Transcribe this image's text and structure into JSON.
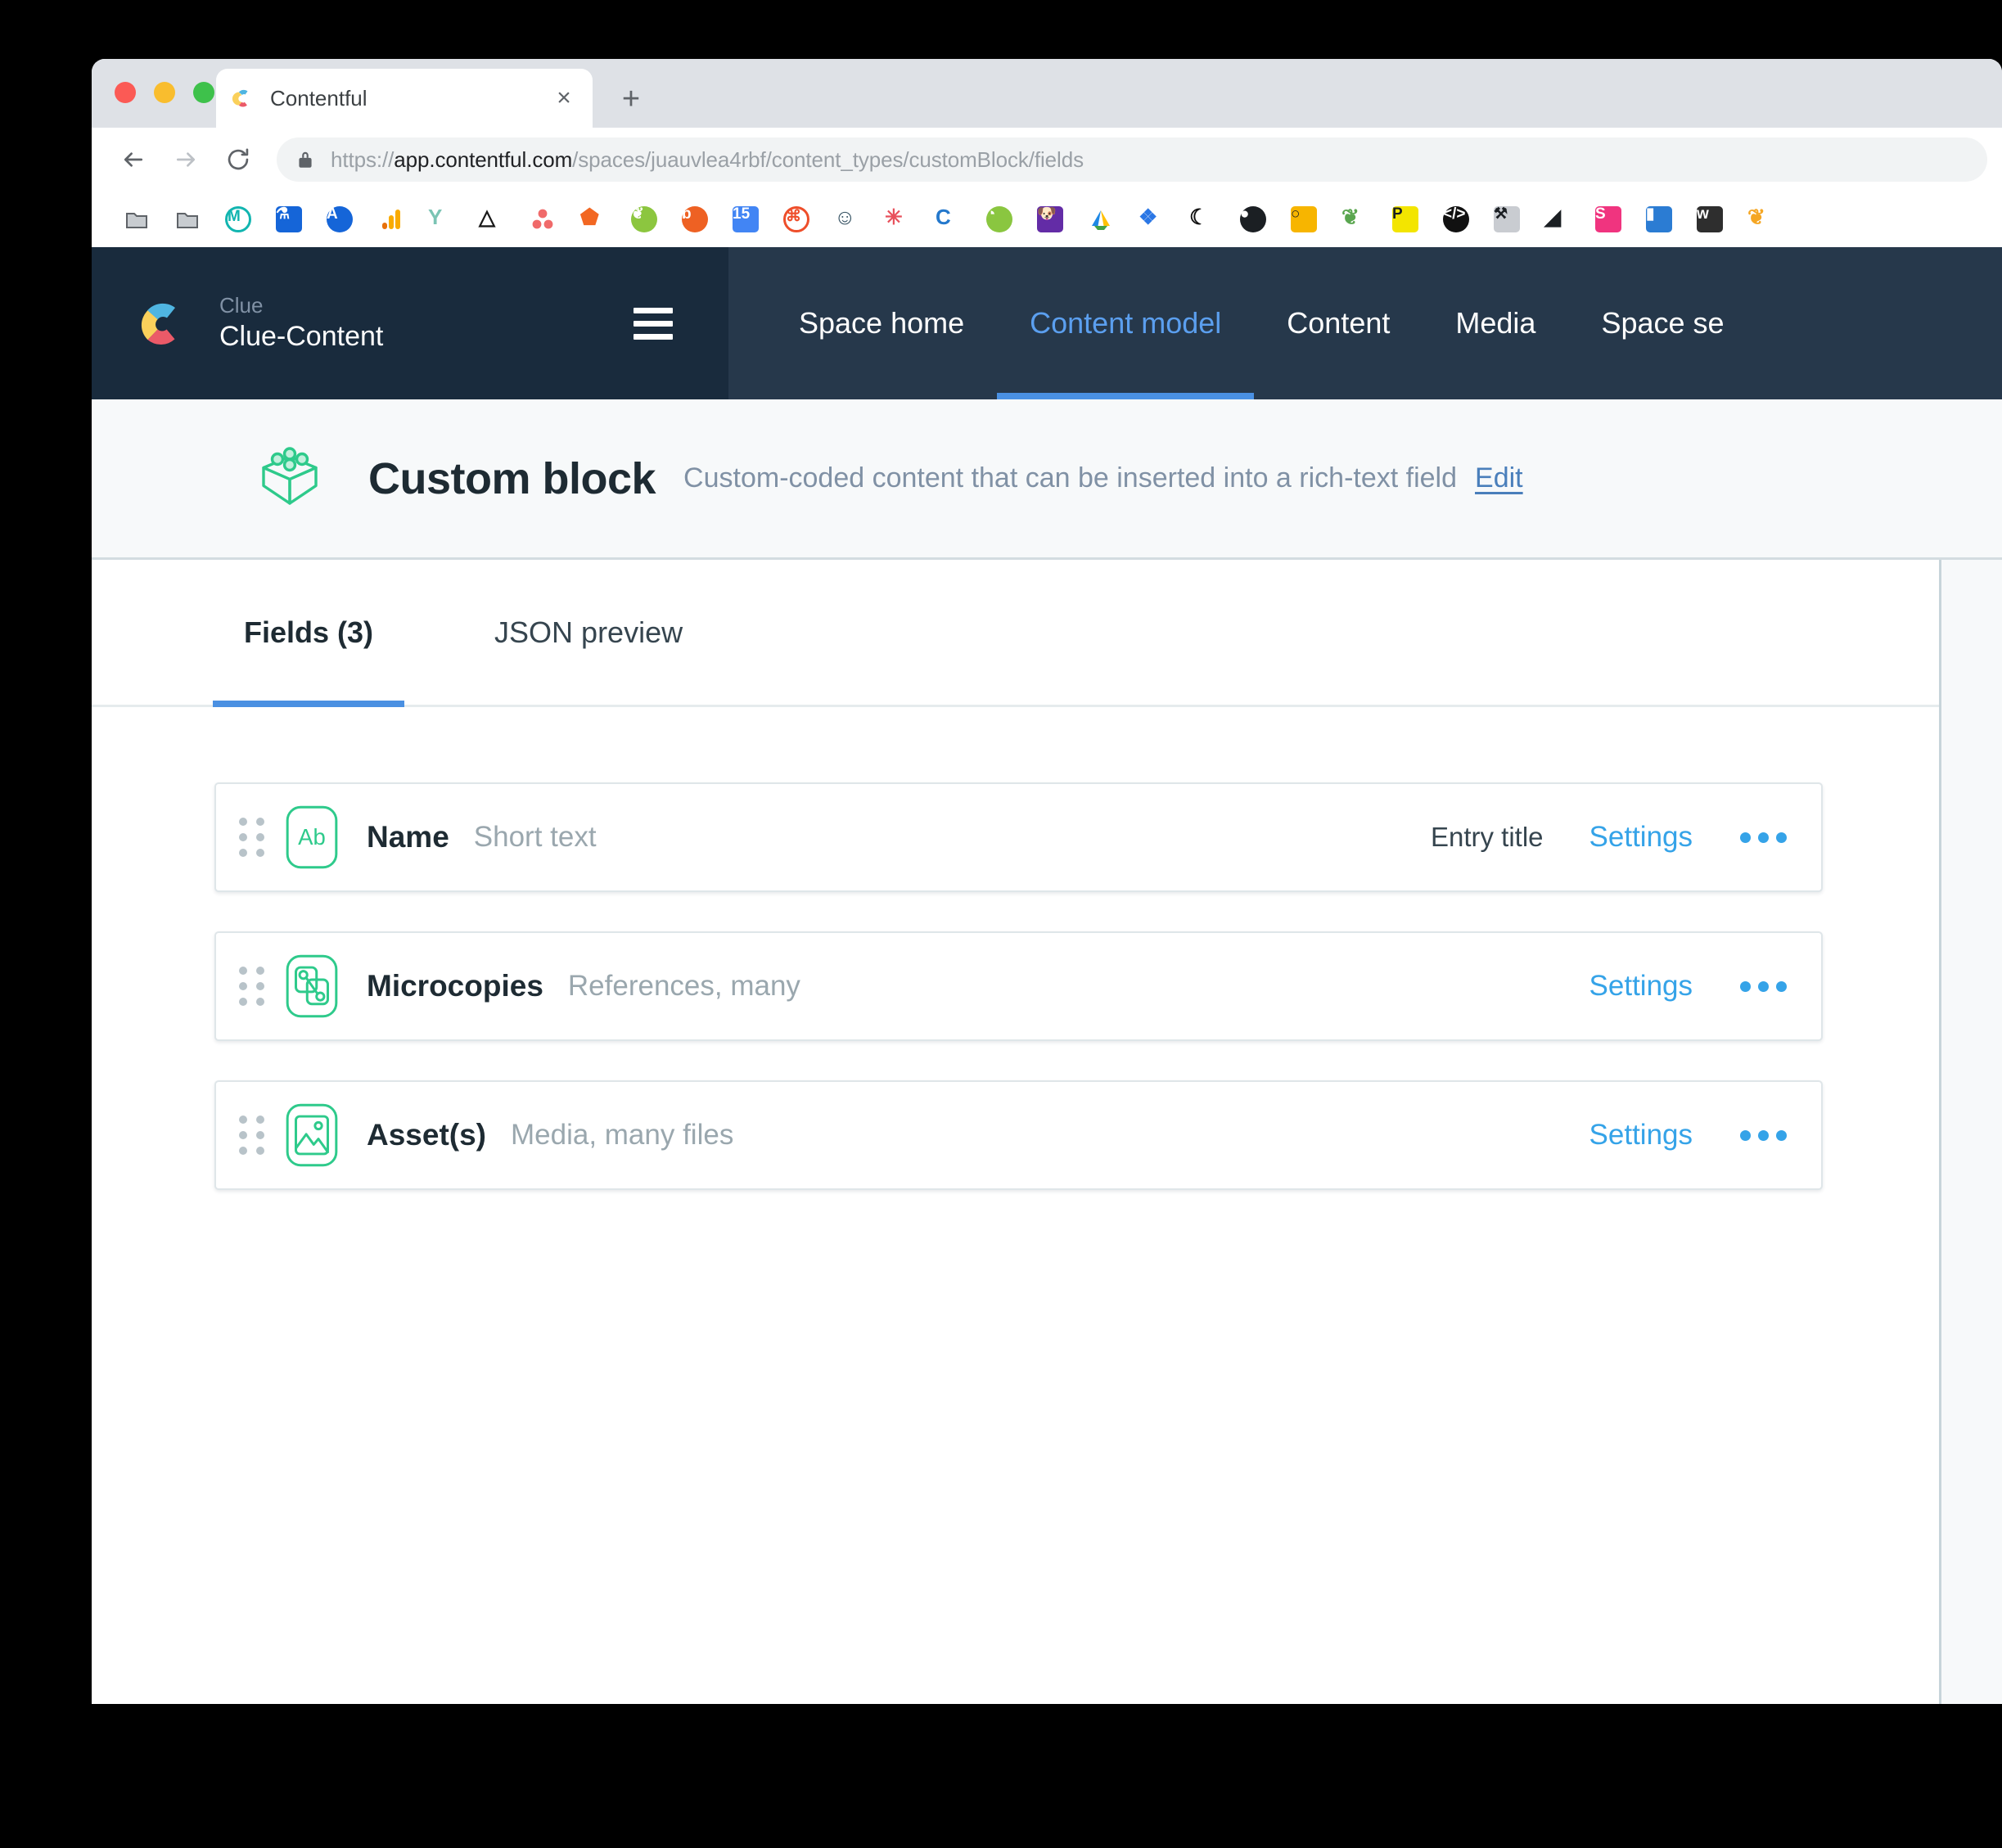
{
  "browser": {
    "tab": {
      "title": "Contentful",
      "favicon": "contentful-favicon",
      "close_label": "×"
    },
    "new_tab_label": "+",
    "back_label": "←",
    "forward_label": "→",
    "reload_label": "↻",
    "url": {
      "scheme": "https://",
      "domain": "app.contentful.com",
      "path": "/spaces/juauvlea4rbf/content_types/customBlock/fields",
      "full": "https://app.contentful.com/spaces/juauvlea4rbf/content_types/customBlock/fields",
      "secure": true
    },
    "bookmarks": [
      {
        "name": "folder-icon",
        "kind": "folder"
      },
      {
        "name": "folder-icon",
        "kind": "folder"
      },
      {
        "name": "mixpanel-icon",
        "kind": "ring",
        "color": "#12b5b0",
        "glyph": "M"
      },
      {
        "name": "flask-icon",
        "kind": "square",
        "color": "#1565d8",
        "glyph": "⚗"
      },
      {
        "name": "amplitude-icon",
        "kind": "circle",
        "color": "#1565d8",
        "glyph": "A"
      },
      {
        "name": "google-analytics-icon",
        "kind": "bars",
        "color": "#f9ab00",
        "glyph": ""
      },
      {
        "name": "terraform-icon",
        "kind": "plain",
        "color": "#7bc4b4",
        "glyph": "Y"
      },
      {
        "name": "abstract-icon",
        "kind": "plain",
        "color": "#191919",
        "glyph": "△"
      },
      {
        "name": "asana-icon",
        "kind": "dots",
        "color": "#f06a6a",
        "glyph": ""
      },
      {
        "name": "cube-icon",
        "kind": "plain",
        "color": "#f26722",
        "glyph": "⬟"
      },
      {
        "name": "leaf-icon",
        "kind": "circle",
        "color": "#8cc63f",
        "glyph": "❦"
      },
      {
        "name": "bitly-icon",
        "kind": "circle",
        "color": "#ee6123",
        "glyph": "b"
      },
      {
        "name": "calendar-icon",
        "kind": "square",
        "color": "#4285f4",
        "glyph": "15"
      },
      {
        "name": "optimizely-icon",
        "kind": "ring",
        "color": "#ee4e2a",
        "glyph": "⌘"
      },
      {
        "name": "jenkins-icon",
        "kind": "plain",
        "color": "#335061",
        "glyph": "☺"
      },
      {
        "name": "snowflake-icon",
        "kind": "plain",
        "color": "#e8505b",
        "glyph": "✳"
      },
      {
        "name": "contentful-icon",
        "kind": "plain",
        "color": "#2478cc",
        "glyph": "C"
      },
      {
        "name": "cypress-icon",
        "kind": "circle",
        "color": "#8ac640",
        "glyph": "◔"
      },
      {
        "name": "datadog-icon",
        "kind": "square",
        "color": "#632ca6",
        "glyph": "🐶"
      },
      {
        "name": "google-drive-icon",
        "kind": "triangle",
        "color": "#1fa463",
        "glyph": ""
      },
      {
        "name": "puzzle-icon",
        "kind": "plain",
        "color": "#2b77e5",
        "glyph": "❖"
      },
      {
        "name": "moon-icon",
        "kind": "plain",
        "color": "#111111",
        "glyph": "☾"
      },
      {
        "name": "github-icon",
        "kind": "circle",
        "color": "#1b1f23",
        "glyph": "●"
      },
      {
        "name": "lightbulb-icon",
        "kind": "square",
        "color": "#f7b500",
        "glyph": "○"
      },
      {
        "name": "sprout-icon",
        "kind": "plain",
        "color": "#5aa64f",
        "glyph": "❦"
      },
      {
        "name": "pendo-icon",
        "kind": "square",
        "color": "#f3e500",
        "glyph": "P"
      },
      {
        "name": "code-icon",
        "kind": "circle",
        "color": "#111111",
        "glyph": "</>"
      },
      {
        "name": "toolbox-icon",
        "kind": "square",
        "color": "#c9ccd1",
        "glyph": "⚒"
      },
      {
        "name": "sentry-icon",
        "kind": "plain",
        "color": "#1b1f23",
        "glyph": "◢"
      },
      {
        "name": "shopify-s-icon",
        "kind": "square",
        "color": "#f0347f",
        "glyph": "S"
      },
      {
        "name": "bookmark-icon",
        "kind": "square",
        "color": "#2b7cd3",
        "glyph": "▮"
      },
      {
        "name": "webflow-icon",
        "kind": "square",
        "color": "#2e2e2e",
        "glyph": "w"
      },
      {
        "name": "bird-icon",
        "kind": "plain",
        "color": "#f5a623",
        "glyph": "❦"
      }
    ]
  },
  "app": {
    "space": {
      "org_label": "Clue",
      "space_name": "Clue-Content",
      "logo_name": "contentful-logo"
    },
    "menu_toggle_name": "hamburger-menu-icon",
    "nav": [
      {
        "label": "Space home",
        "active": false
      },
      {
        "label": "Content model",
        "active": true
      },
      {
        "label": "Content",
        "active": false
      },
      {
        "label": "Media",
        "active": false
      },
      {
        "label": "Space se",
        "active": false
      }
    ],
    "content_type": {
      "icon_name": "lego-block-icon",
      "title": "Custom block",
      "description": "Custom-coded content that can be inserted into a rich-text field",
      "edit_label": "Edit"
    },
    "tabs": [
      {
        "label": "Fields (3)",
        "active": true
      },
      {
        "label": "JSON preview",
        "active": false
      }
    ],
    "fields": [
      {
        "icon": "short-text-icon",
        "name": "Name",
        "type": "Short text",
        "badge": "Entry title",
        "settings_label": "Settings",
        "more_label": "•••"
      },
      {
        "icon": "references-icon",
        "name": "Microcopies",
        "type": "References, many",
        "badge": "",
        "settings_label": "Settings",
        "more_label": "•••"
      },
      {
        "icon": "media-image-icon",
        "name": "Asset(s)",
        "type": "Media, many files",
        "badge": "",
        "settings_label": "Settings",
        "more_label": "•••"
      }
    ]
  },
  "colors": {
    "accent_blue": "#4a90e2",
    "link_blue": "#35a3e8",
    "green": "#2eca8b",
    "nav_dark": "#26384b",
    "sidebar_dark": "#192b3d"
  }
}
